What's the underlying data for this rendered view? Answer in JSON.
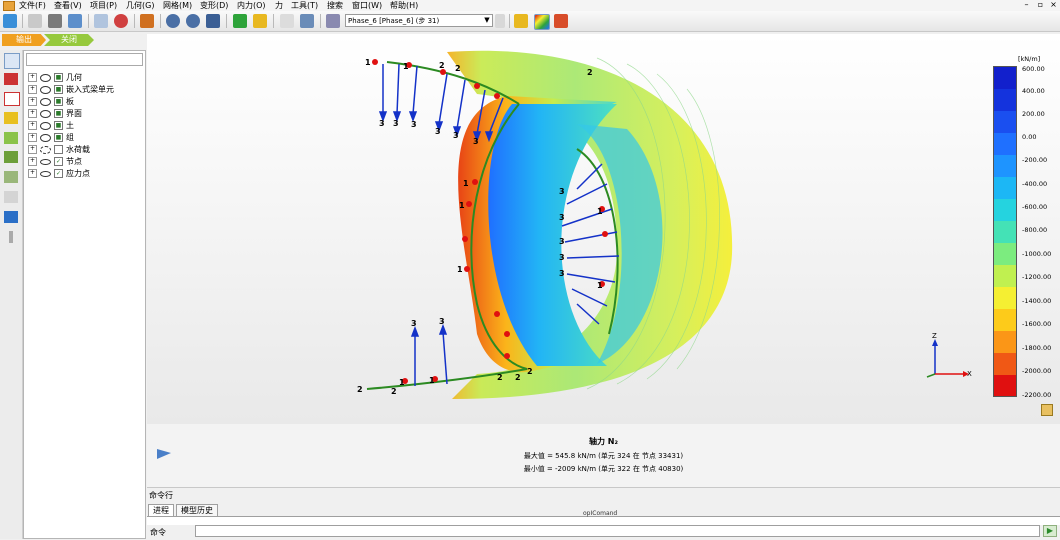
{
  "menubar": {
    "items": [
      "文件(F)",
      "查看(V)",
      "项目(P)",
      "几何(G)",
      "网格(M)",
      "变形(D)",
      "内力(O)",
      "力",
      "工具(T)",
      "搜索",
      "窗口(W)",
      "帮助(H)"
    ],
    "win_min": "–",
    "win_restore": "▫",
    "win_close": "×"
  },
  "toolbar": {
    "phase_value": "Phase_6 [Phase_6] (步 31)"
  },
  "breadcrumb": {
    "output": "输出",
    "close": "关闭"
  },
  "tree": {
    "items": [
      {
        "label": "几何",
        "icon": "eye"
      },
      {
        "label": "嵌入式梁单元",
        "icon": "eye"
      },
      {
        "label": "板",
        "icon": "eye"
      },
      {
        "label": "界面",
        "icon": "eye"
      },
      {
        "label": "土",
        "icon": "eye"
      },
      {
        "label": "组",
        "icon": "eye"
      },
      {
        "label": "水荷载",
        "icon": "eye-hidden"
      },
      {
        "label": "节点",
        "icon": "eye-closed"
      },
      {
        "label": "应力点",
        "icon": "eye-closed"
      }
    ]
  },
  "legend": {
    "unit": "[kN/m]",
    "labels": [
      "600.00",
      "400.00",
      "200.00",
      "0.00",
      "-200.00",
      "-400.00",
      "-600.00",
      "-800.00",
      "-1000.00",
      "-1200.00",
      "-1400.00",
      "-1600.00",
      "-1800.00",
      "-2000.00",
      "-2200.00"
    ],
    "colors": [
      "#1220cc",
      "#1433dd",
      "#1a4ff0",
      "#1f70ff",
      "#1e94ff",
      "#1cb7f5",
      "#25d3df",
      "#44e2b6",
      "#7cec7f",
      "#c0f050",
      "#f5ef32",
      "#fdcb1a",
      "#fb9617",
      "#f05815",
      "#e01010"
    ]
  },
  "axes": {
    "z": "Z",
    "x": "X"
  },
  "info": {
    "title": "轴力 N₂",
    "max_line": "最大值 = 545.8 kN/m (单元 324 在 节点 33431)",
    "min_line": "最小值 = -2009 kN/m (单元 322 在 节点 40830)"
  },
  "command": {
    "pane_label": "命令行",
    "tab_progress": "进程",
    "tab_history": "模型历史",
    "center_text": "opIComand",
    "input_label": "命令"
  },
  "annotations": {
    "one": "1",
    "two": "2",
    "three": "3"
  }
}
